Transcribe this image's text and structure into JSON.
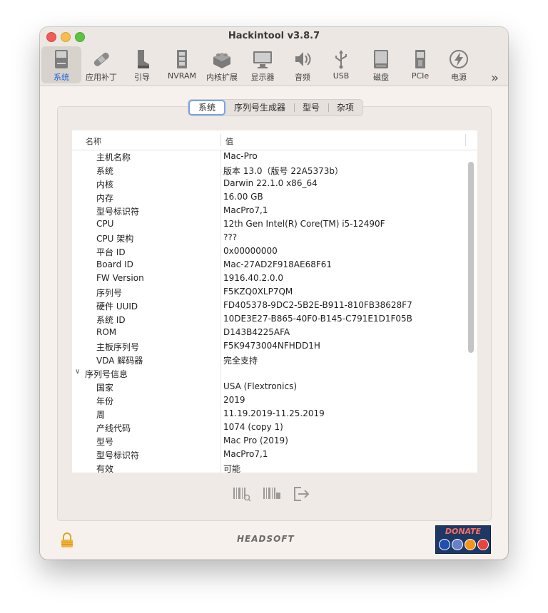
{
  "window": {
    "title": "Hackintool v3.8.7"
  },
  "toolbar": {
    "items": [
      {
        "label": "系统",
        "icon": "mac-computer-icon"
      },
      {
        "label": "应用补丁",
        "icon": "bandage-icon"
      },
      {
        "label": "引导",
        "icon": "boot-icon"
      },
      {
        "label": "NVRAM",
        "icon": "memory-chip-icon"
      },
      {
        "label": "内核扩展",
        "icon": "lego-brick-icon"
      },
      {
        "label": "显示器",
        "icon": "display-icon"
      },
      {
        "label": "音频",
        "icon": "speaker-icon"
      },
      {
        "label": "USB",
        "icon": "usb-icon"
      },
      {
        "label": "磁盘",
        "icon": "disk-icon"
      },
      {
        "label": "PCIe",
        "icon": "pcie-card-icon"
      },
      {
        "label": "电源",
        "icon": "power-bolt-icon"
      }
    ],
    "more": "»"
  },
  "tabs": [
    {
      "label": "系统",
      "active": true
    },
    {
      "label": "序列号生成器",
      "active": false
    },
    {
      "label": "型号",
      "active": false
    },
    {
      "label": "杂项",
      "active": false
    }
  ],
  "table": {
    "columns": [
      "名称",
      "值"
    ],
    "rows": [
      {
        "name": "主机名称",
        "value": "Mac-Pro"
      },
      {
        "name": "系统",
        "value": " 版本 13.0（版号 22A5373b）"
      },
      {
        "name": "内核",
        "value": "Darwin 22.1.0 x86_64"
      },
      {
        "name": "内存",
        "value": "16.00 GB"
      },
      {
        "name": "型号标识符",
        "value": "MacPro7,1"
      },
      {
        "name": "CPU",
        "value": "12th Gen Intel(R) Core(TM) i5-12490F"
      },
      {
        "name": "CPU 架构",
        "value": "???"
      },
      {
        "name": "平台 ID",
        "value": "0x00000000"
      },
      {
        "name": "Board ID",
        "value": "Mac-27AD2F918AE68F61"
      },
      {
        "name": "FW Version",
        "value": "1916.40.2.0.0"
      },
      {
        "name": "序列号",
        "value": "F5KZQ0XLP7QM"
      },
      {
        "name": "硬件 UUID",
        "value": "FD405378-9DC2-5B2E-B911-810FB38628F7"
      },
      {
        "name": "系统 ID",
        "value": "10DE3E27-B865-40F0-B145-C791E1D1F05B"
      },
      {
        "name": "ROM",
        "value": "D143B4225AFA"
      },
      {
        "name": "主板序列号",
        "value": "F5K9473004NFHDD1H"
      },
      {
        "name": "VDA 解码器",
        "value": "完全支持"
      },
      {
        "name": "序列号信息",
        "value": "",
        "group": true
      },
      {
        "name": "国家",
        "value": "USA (Flextronics)"
      },
      {
        "name": "年份",
        "value": "2019"
      },
      {
        "name": "周",
        "value": "11.19.2019-11.25.2019"
      },
      {
        "name": "产线代码",
        "value": "1074 (copy 1)"
      },
      {
        "name": "型号",
        "value": "Mac Pro (2019)"
      },
      {
        "name": "型号标识符",
        "value": "MacPro7,1"
      },
      {
        "name": "有效",
        "value": "可能"
      }
    ]
  },
  "footer": {
    "brand": "HEADSOFT",
    "donate_label": "DONATE",
    "coin_colors": [
      "#1f4fb0",
      "#6b7fc8",
      "#f7931a",
      "#e8443a"
    ]
  }
}
